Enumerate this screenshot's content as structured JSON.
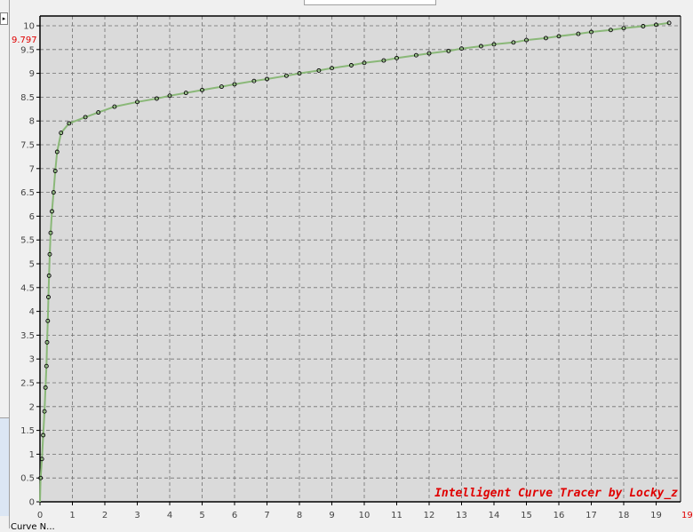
{
  "window": {
    "left_arrow_glyph": "▸",
    "bottom_label": "Curve N..."
  },
  "colors": {
    "plot_bg": "#dadada",
    "grid": "#707070",
    "curve": "#8ab878",
    "points": "#000000",
    "highlight_text": "#e00000"
  },
  "chart_data": {
    "type": "line",
    "title": "",
    "xlabel": "",
    "ylabel": "",
    "xlim": [
      0,
      19.8
    ],
    "ylim": [
      0,
      10.2
    ],
    "grid": true,
    "x_ticks": [
      0,
      1,
      2,
      3,
      4,
      5,
      6,
      7,
      8,
      9,
      10,
      11,
      12,
      13,
      14,
      15,
      16,
      17,
      18,
      19
    ],
    "y_ticks": [
      0,
      0.5,
      1,
      1.5,
      2,
      2.5,
      3,
      3.5,
      4,
      4.5,
      5,
      5.5,
      6,
      6.5,
      7,
      7.5,
      8,
      8.5,
      9,
      9.5,
      10
    ],
    "y_tick_labels": [
      "0",
      "0.5",
      "1",
      "1.5",
      "2",
      "2.5",
      "3",
      "3.5",
      "4",
      "4.5",
      "5",
      "5.5",
      "6",
      "6.5",
      "7",
      "7.5",
      "8",
      "8.5",
      "9",
      "9.5",
      "10"
    ],
    "highlight_y_label": "9.797",
    "highlight_x_label": "19",
    "annotation": "Intelligent Curve Tracer by Locky_z",
    "series": [
      {
        "x": [
          0.02,
          0.06,
          0.1,
          0.14,
          0.17,
          0.2,
          0.22,
          0.24,
          0.26,
          0.28,
          0.3,
          0.33,
          0.37,
          0.42,
          0.47,
          0.53,
          0.65,
          0.9,
          1.4,
          1.8,
          2.3,
          3.0,
          3.6,
          4.0,
          4.5,
          5.0,
          5.6,
          6.0,
          6.6,
          7.0,
          7.6,
          8.0,
          8.6,
          9.0,
          9.6,
          10.0,
          10.6,
          11.0,
          11.6,
          12.0,
          12.6,
          13.0,
          13.6,
          14.0,
          14.6,
          15.0,
          15.6,
          16.0,
          16.6,
          17.0,
          17.6,
          18.0,
          18.6,
          19.0,
          19.4
        ],
        "y": [
          0.5,
          0.9,
          1.4,
          1.9,
          2.4,
          2.85,
          3.35,
          3.8,
          4.3,
          4.75,
          5.2,
          5.65,
          6.1,
          6.5,
          6.95,
          7.35,
          7.75,
          7.95,
          8.08,
          8.18,
          8.3,
          8.4,
          8.47,
          8.53,
          8.59,
          8.65,
          8.72,
          8.77,
          8.84,
          8.88,
          8.95,
          9.0,
          9.06,
          9.11,
          9.17,
          9.22,
          9.27,
          9.32,
          9.38,
          9.42,
          9.47,
          9.52,
          9.57,
          9.61,
          9.65,
          9.7,
          9.74,
          9.78,
          9.83,
          9.87,
          9.91,
          9.95,
          9.99,
          10.02,
          10.06
        ]
      }
    ]
  }
}
